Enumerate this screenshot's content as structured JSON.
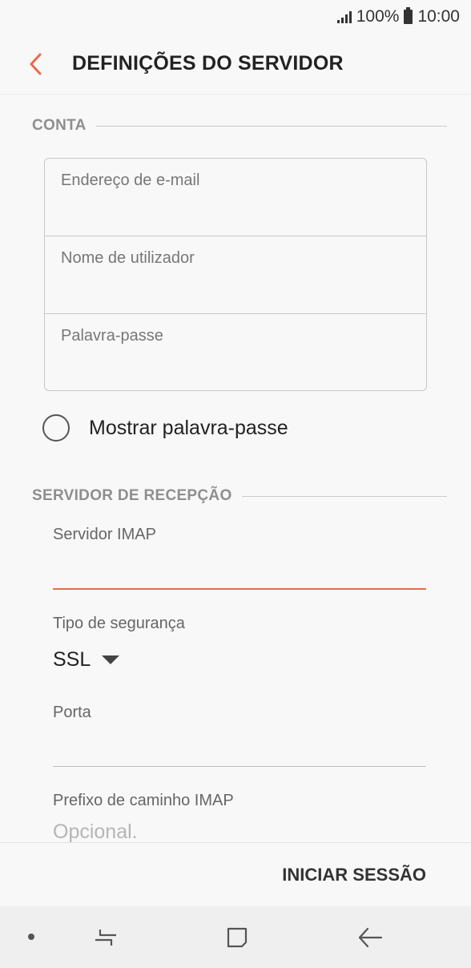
{
  "status": {
    "battery_percent": "100%",
    "time": "10:00"
  },
  "header": {
    "title": "DEFINIÇÕES DO SERVIDOR"
  },
  "account": {
    "section_label": "CONTA",
    "email_placeholder": "Endereço de e-mail",
    "username_placeholder": "Nome de utilizador",
    "password_placeholder": "Palavra-passe",
    "show_password_label": "Mostrar palavra-passe",
    "show_password_checked": false
  },
  "incoming": {
    "section_label": "SERVIDOR DE RECEPÇÃO",
    "server_label": "Servidor IMAP",
    "server_value": "",
    "security_label": "Tipo de segurança",
    "security_value": "SSL",
    "port_label": "Porta",
    "port_value": "",
    "prefix_label": "Prefixo de caminho IMAP",
    "prefix_placeholder": "Opcional."
  },
  "footer": {
    "signin_label": "INICIAR SESSÃO"
  },
  "colors": {
    "accent": "#ec6a47",
    "section_label": "#8e8e8e",
    "background": "#f8f8f8"
  },
  "icons": {
    "back": "chevron-left-icon",
    "recents": "recents-icon",
    "home": "home-icon",
    "nav_back": "nav-back-icon"
  }
}
